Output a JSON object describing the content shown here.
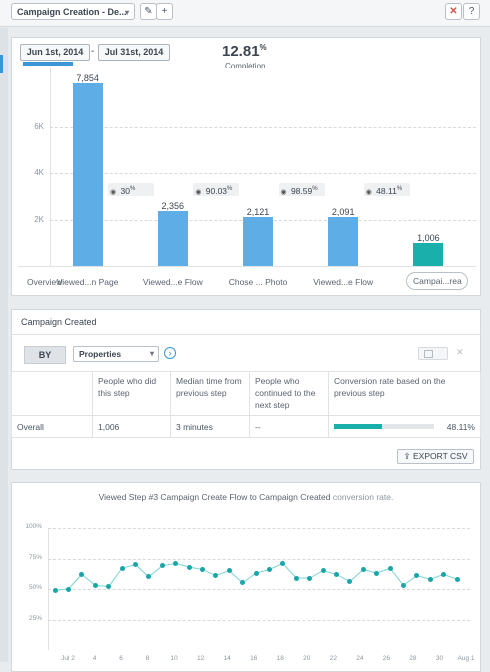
{
  "toolbar": {
    "funnel_name": "Campaign Creation - De...",
    "edit_icon": "pencil-icon",
    "add_icon": "plus-icon",
    "close_icon": "x-icon",
    "help_icon": "question-icon"
  },
  "dates": {
    "start": "Jun 1st, 2014",
    "separator": "-",
    "end": "Jul 31st, 2014"
  },
  "completion": {
    "value": "12.81",
    "unit": "%",
    "label": "Completion"
  },
  "chart_data": {
    "type": "bar",
    "categories": [
      "Viewed...n Page",
      "Viewed...e Flow",
      "Chose ... Photo",
      "Viewed...e Flow",
      "Campai...rea"
    ],
    "values": [
      7854,
      2356,
      2121,
      2091,
      1006
    ],
    "value_labels": [
      "7,854",
      "2,356",
      "2,121",
      "2,091",
      "1,006"
    ],
    "ylim": [
      0,
      8000
    ],
    "yticks": [
      "2K",
      "4K",
      "6K"
    ],
    "conversions": [
      "30",
      "90.03",
      "98.59",
      "48.11"
    ],
    "conversion_unit": "%",
    "grid": true
  },
  "overview_label": "Overview",
  "step_panel": {
    "title": "Campaign Created",
    "by_label": "BY",
    "properties_label": "Properties",
    "columns": [
      "",
      "People who did this step",
      "Median time from previous step",
      "People who continued to the next step",
      "Conversion rate based on the previous step"
    ],
    "row": {
      "label": "Overall",
      "people": "1,006",
      "median": "3 minutes",
      "continued": "--",
      "rate": "48.11%",
      "rate_fraction": 0.4811
    },
    "export_label": "EXPORT CSV"
  },
  "trend": {
    "title_prefix": "Viewed Step #3 Campaign Create Flow to Campaign Created",
    "title_suffix": " conversion rate.",
    "yticks": [
      "100%",
      "75%",
      "50%",
      "25%"
    ],
    "ylim": [
      0,
      100
    ],
    "xticks": [
      "Jul 2",
      "4",
      "6",
      "8",
      "10",
      "12",
      "14",
      "16",
      "18",
      "20",
      "22",
      "24",
      "26",
      "28",
      "30",
      "Aug 1"
    ],
    "values": [
      49,
      50,
      62,
      53,
      52,
      67,
      70,
      60,
      69,
      71,
      68,
      66,
      61,
      65,
      55,
      63,
      66,
      71,
      59,
      59,
      65,
      62,
      56,
      66,
      63,
      67,
      53,
      61,
      58,
      62,
      58
    ]
  }
}
